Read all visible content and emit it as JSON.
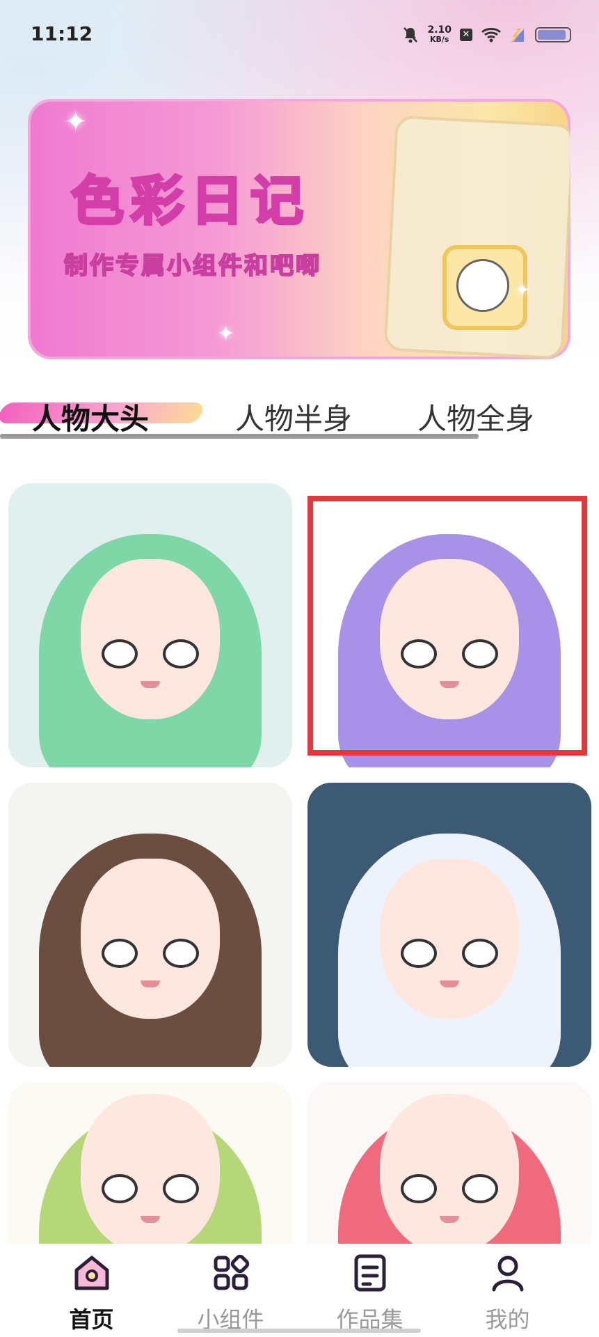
{
  "status_bar": {
    "time": "11:12",
    "speed_value": "2.10",
    "speed_unit": "KB/s",
    "battery_level": 0.9
  },
  "banner": {
    "title": "色彩日记",
    "subtitle": "制作专属小组件和吧唧"
  },
  "tabs": [
    {
      "label": "人物大头",
      "active": true
    },
    {
      "label": "人物半身",
      "active": false
    },
    {
      "label": "人物全身",
      "active": false
    }
  ],
  "gallery": [
    {
      "name": "green-hair-girl",
      "bg": "#dff0ee",
      "hair": "#7fd6a6"
    },
    {
      "name": "purple-hair-girl",
      "bg": "#ffffff",
      "hair": "#a892e8",
      "selected": true
    },
    {
      "name": "brown-hair-girl",
      "bg": "#f4f4f0",
      "hair": "#6b4e3f"
    },
    {
      "name": "silver-hair-girl",
      "bg": "#3d5a74",
      "hair": "#eef2fb"
    },
    {
      "name": "lime-hair-elf",
      "bg": "#fbfbf4",
      "hair": "#b6d67a"
    },
    {
      "name": "pink-hair-witch",
      "bg": "#fdf8f8",
      "hair": "#ef6a7d"
    }
  ],
  "nav": [
    {
      "label": "首页",
      "icon": "home-icon",
      "active": true
    },
    {
      "label": "小组件",
      "icon": "widgets-icon",
      "active": false
    },
    {
      "label": "作品集",
      "icon": "portfolio-icon",
      "active": false
    },
    {
      "label": "我的",
      "icon": "profile-icon",
      "active": false
    }
  ],
  "colors": {
    "accent": "#f14fb8",
    "selection": "#e1393b",
    "nav_active": "#2b1f3a"
  }
}
